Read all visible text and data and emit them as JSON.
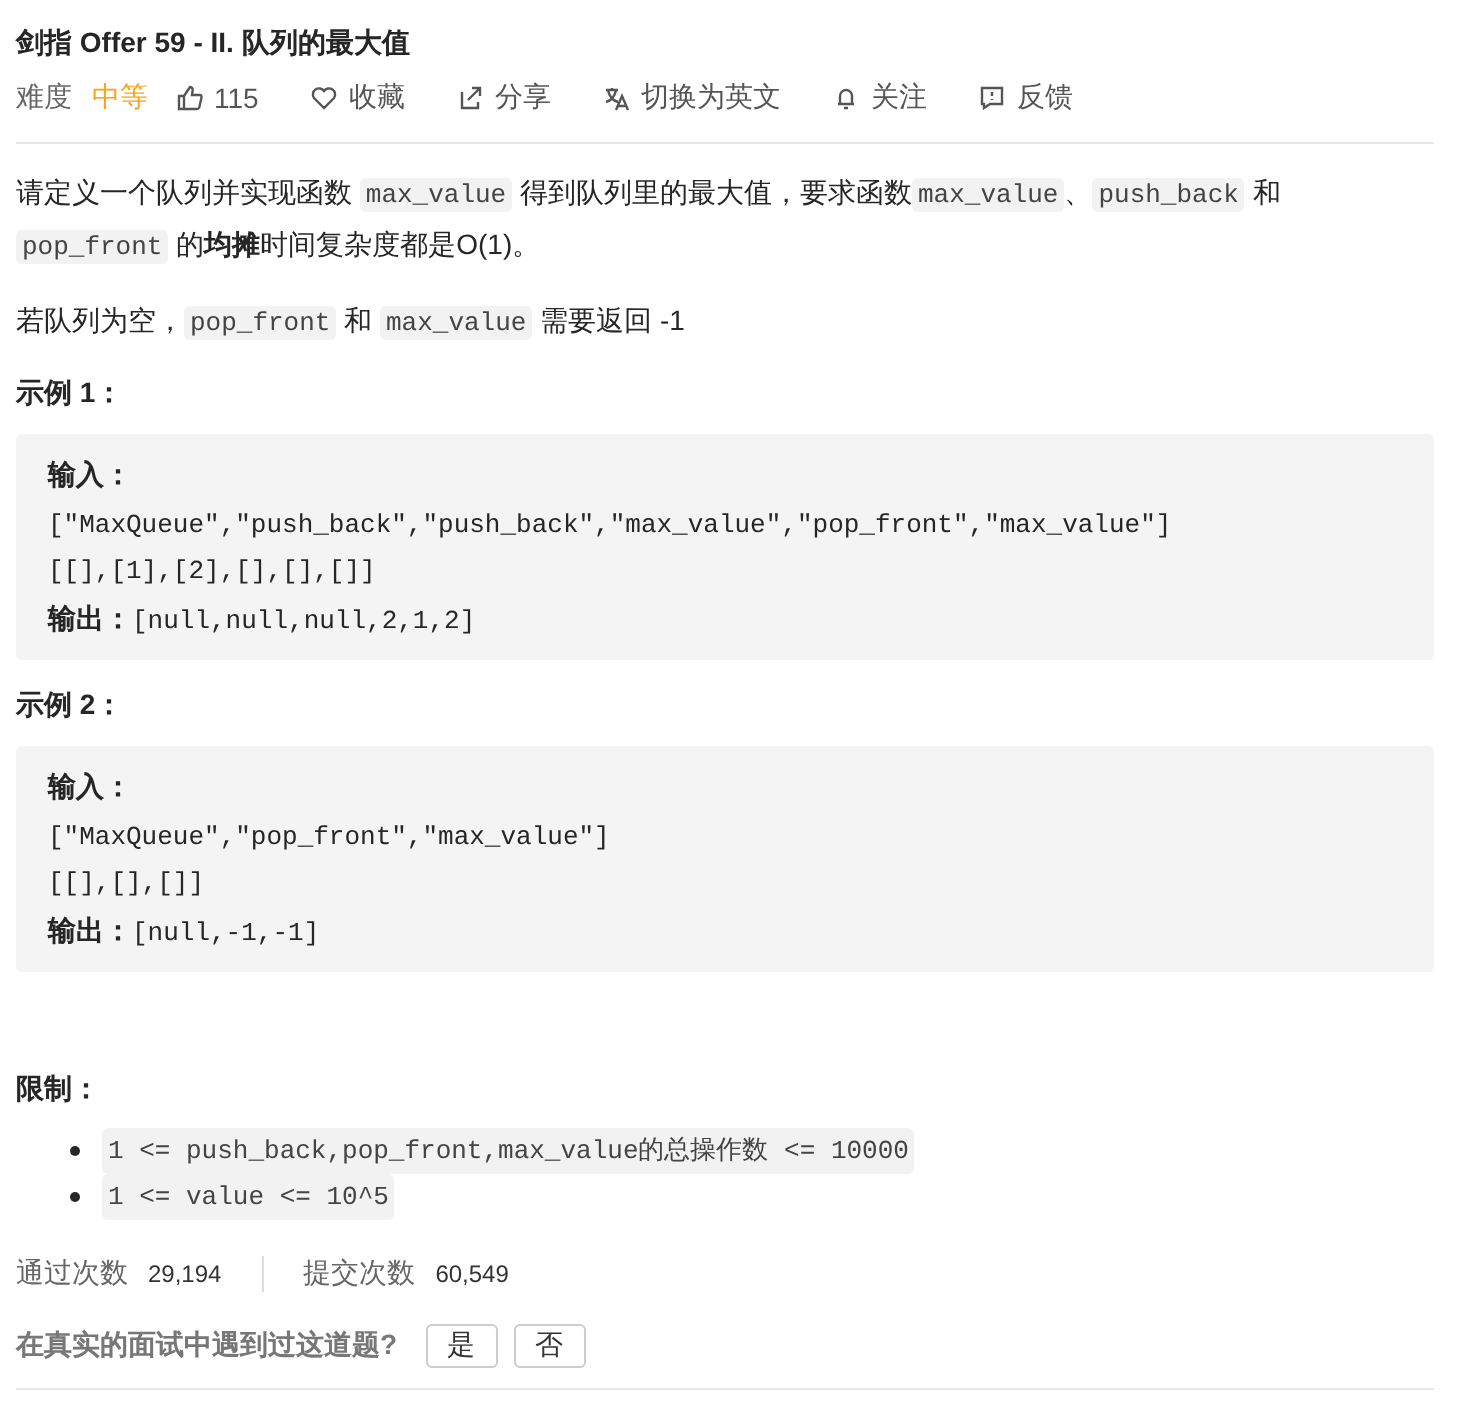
{
  "title": "剑指 Offer 59 - II. 队列的最大值",
  "meta": {
    "difficulty_label": "难度",
    "difficulty": "中等",
    "likes": "115",
    "actions": [
      {
        "label": "收藏"
      },
      {
        "label": "分享"
      },
      {
        "label": "切换为英文"
      },
      {
        "label": "关注"
      },
      {
        "label": "反馈"
      }
    ]
  },
  "description": [
    [
      {
        "kind": "text",
        "text": "请定义一个队列并实现函数 "
      },
      {
        "kind": "code",
        "text": "max_value"
      },
      {
        "kind": "text",
        "text": " 得到队列里的最大值，要求函数"
      },
      {
        "kind": "code",
        "text": "max_value"
      },
      {
        "kind": "text",
        "text": "、"
      },
      {
        "kind": "code",
        "text": "push_back"
      },
      {
        "kind": "text",
        "text": " 和 "
      },
      {
        "kind": "code",
        "text": "pop_front"
      },
      {
        "kind": "text",
        "text": " 的**均摊**时间复杂度都是O(1)。"
      }
    ],
    [
      {
        "kind": "text",
        "text": "若队列为空，"
      },
      {
        "kind": "code",
        "text": "pop_front"
      },
      {
        "kind": "text",
        "text": " 和 "
      },
      {
        "kind": "code",
        "text": "max_value"
      },
      {
        "kind": "text",
        "text": " 需要返回 -1"
      }
    ]
  ],
  "examples": [
    {
      "heading": "示例 1：",
      "input_label": "输入：",
      "lines": [
        "[\"MaxQueue\",\"push_back\",\"push_back\",\"max_value\",\"pop_front\",\"max_value\"]",
        "[[],[1],[2],[],[],[]]"
      ],
      "output_label": "输出：",
      "output": "[null,null,null,2,1,2]"
    },
    {
      "heading": "示例 2：",
      "input_label": "输入：",
      "lines": [
        "[\"MaxQueue\",\"pop_front\",\"max_value\"]",
        "[[],[],[]]"
      ],
      "output_label": "输出：",
      "output": "[null,-1,-1]"
    }
  ],
  "limits": {
    "heading": "限制：",
    "items": [
      "1 <= push_back,pop_front,max_value的总操作数  <= 10000",
      "1 <= value <= 10^5"
    ]
  },
  "stats": [
    {
      "label": "通过次数",
      "value": "29,194"
    },
    {
      "label": "提交次数",
      "value": "60,549"
    }
  ],
  "interview": {
    "question": "在真实的面试中遇到过这道题?",
    "buttons": [
      "是",
      "否"
    ]
  }
}
